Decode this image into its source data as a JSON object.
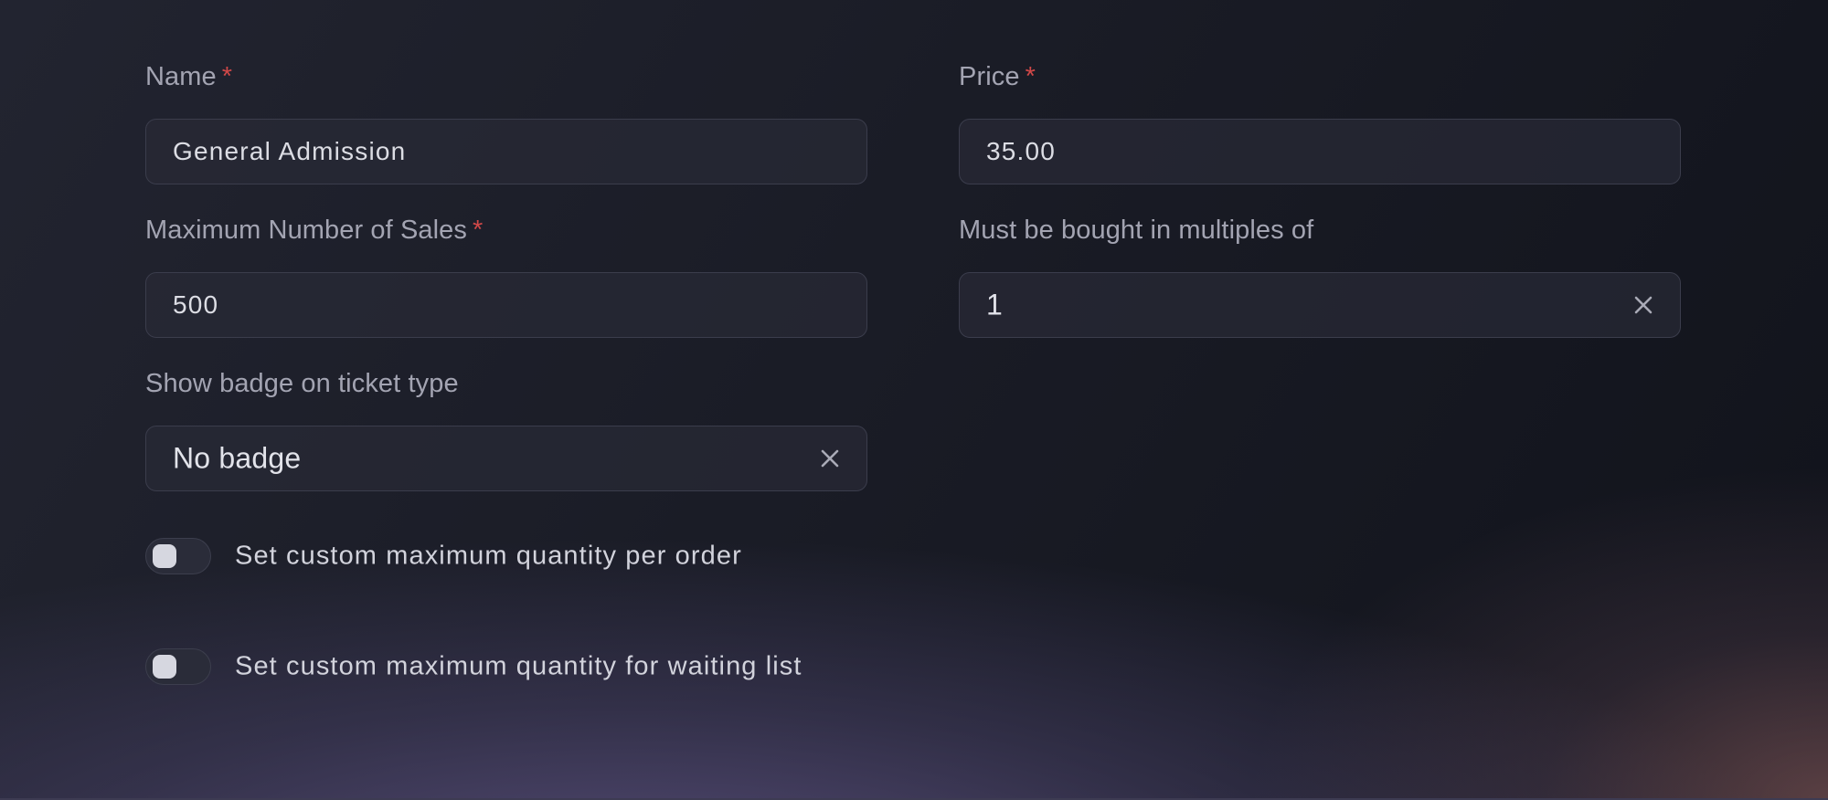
{
  "form": {
    "name": {
      "label": "Name",
      "required_mark": "*",
      "value": "General Admission"
    },
    "price": {
      "label": "Price",
      "required_mark": "*",
      "value": "35.00"
    },
    "max_sales": {
      "label": "Maximum Number of Sales",
      "required_mark": "*",
      "value": "500"
    },
    "multiples": {
      "label": "Must be bought in multiples of",
      "value": "1",
      "clear_icon": "close-icon"
    },
    "badge": {
      "label": "Show badge on ticket type",
      "value": "No badge",
      "clear_icon": "close-icon"
    },
    "toggles": [
      {
        "label": "Set custom maximum quantity per order",
        "checked": false
      },
      {
        "label": "Set custom maximum quantity for waiting list",
        "checked": false
      }
    ]
  },
  "colors": {
    "required": "#d04848",
    "label": "#a3a4b2",
    "input_border": "#3b3d4c",
    "text": "#dcdde4"
  }
}
